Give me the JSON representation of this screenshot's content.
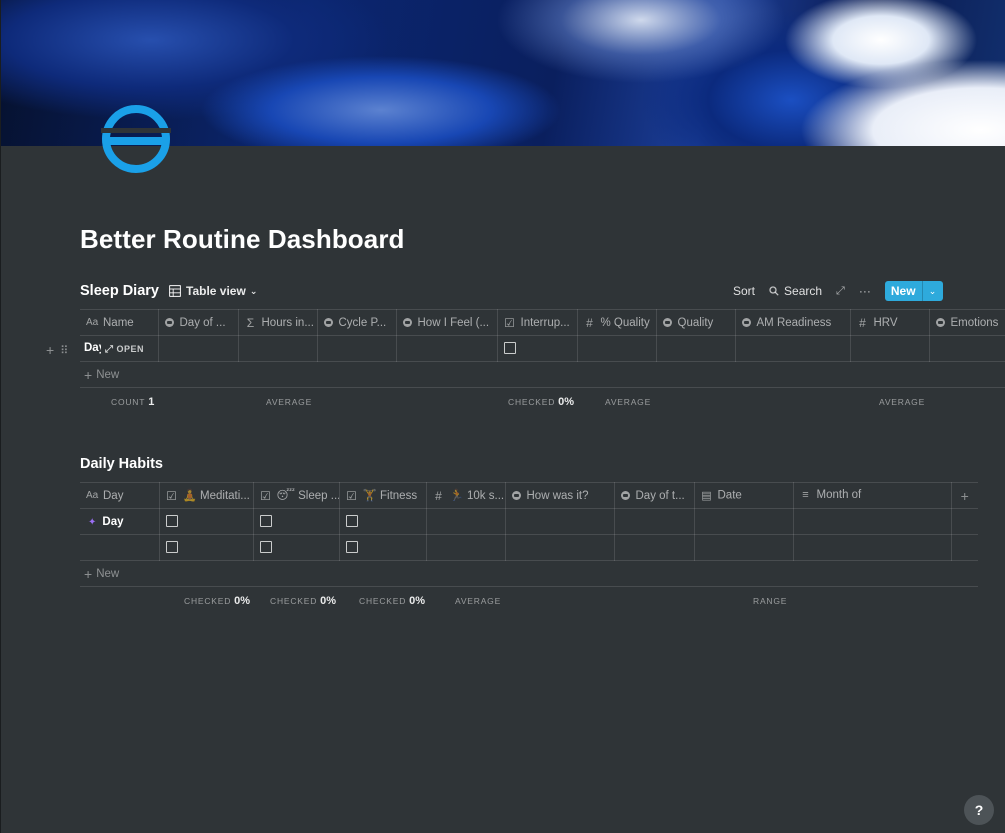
{
  "page": {
    "title": "Better Routine Dashboard",
    "accent_color": "#2eaadc",
    "icon_color": "#1aa0e8"
  },
  "sleep_diary": {
    "title": "Sleep Diary",
    "view_label": "Table view",
    "toolbar": {
      "sort": "Sort",
      "search": "Search",
      "new": "New"
    },
    "columns": [
      {
        "icon": "text-icon",
        "label": "Name"
      },
      {
        "icon": "select-icon",
        "label": "Day of ..."
      },
      {
        "icon": "sigma-icon",
        "label": "Hours in..."
      },
      {
        "icon": "select-icon",
        "label": "Cycle P..."
      },
      {
        "icon": "select-icon",
        "label": "How I Feel (..."
      },
      {
        "icon": "checkbox-icon",
        "label": "Interrup..."
      },
      {
        "icon": "number-icon",
        "label": "% Quality"
      },
      {
        "icon": "select-icon",
        "label": "Quality"
      },
      {
        "icon": "select-icon",
        "label": "AM Readiness"
      },
      {
        "icon": "number-icon",
        "label": "HRV"
      },
      {
        "icon": "select-icon",
        "label": "Emotions"
      }
    ],
    "row": {
      "name": "Day",
      "open_label": "OPEN"
    },
    "new_row": "New",
    "calcs": {
      "count_label": "COUNT",
      "count_value": "1",
      "average_1": "AVERAGE",
      "checked_label": "CHECKED",
      "checked_value": "0%",
      "average_2": "AVERAGE",
      "average_3": "AVERAGE"
    }
  },
  "daily_habits": {
    "title": "Daily Habits",
    "columns": [
      {
        "icon": "text-icon",
        "label": "Day"
      },
      {
        "icon": "checkbox-icon",
        "label": "🧘 Meditati..."
      },
      {
        "icon": "checkbox-icon",
        "label": "😴 Sleep ..."
      },
      {
        "icon": "checkbox-icon",
        "label": "🏋 Fitness"
      },
      {
        "icon": "number-icon",
        "label": "🏃 10k s..."
      },
      {
        "icon": "select-icon",
        "label": "How was it?"
      },
      {
        "icon": "select-icon",
        "label": "Day of t..."
      },
      {
        "icon": "calendar-icon",
        "label": "Date"
      },
      {
        "icon": "lines-icon",
        "label": "Month of"
      }
    ],
    "row1_name": "Day",
    "new_row": "New",
    "calcs": {
      "checked_label_1": "CHECKED",
      "checked_value_1": "0%",
      "checked_label_2": "CHECKED",
      "checked_value_2": "0%",
      "checked_label_3": "CHECKED",
      "checked_value_3": "0%",
      "average": "AVERAGE",
      "range": "RANGE"
    }
  },
  "help": {
    "label": "?"
  }
}
